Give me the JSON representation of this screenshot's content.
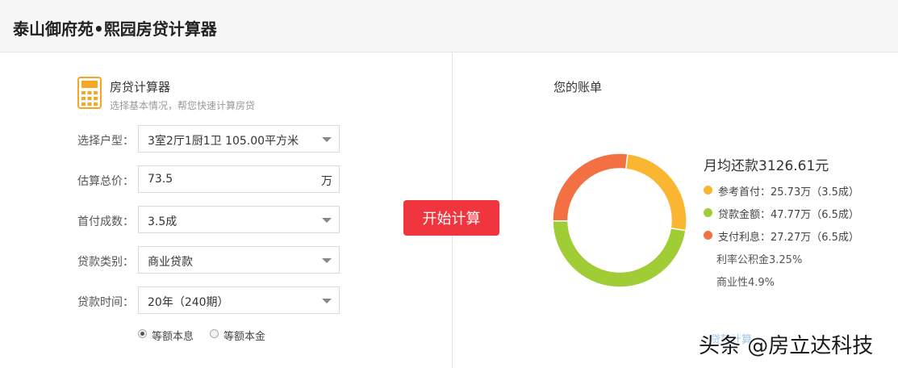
{
  "header": {
    "title": "泰山御府苑•熙园房贷计算器"
  },
  "calculator": {
    "title": "房贷计算器",
    "subtitle": "选择基本情况，帮您快速计算房贷",
    "icon": "calculator-icon"
  },
  "form": {
    "unit_type": {
      "label": "选择户型：",
      "value": "3室2厅1厨1卫 105.00平方米"
    },
    "total_price": {
      "label": "估算总价：",
      "value": "73.5",
      "unit": "万"
    },
    "down_payment": {
      "label": "首付成数：",
      "value": "3.5成"
    },
    "loan_type": {
      "label": "贷款类别：",
      "value": "商业贷款"
    },
    "loan_term": {
      "label": "贷款时间：",
      "value": "20年（240期）"
    },
    "repayment": {
      "options": [
        "等额本息",
        "等额本金"
      ],
      "selected": "等额本息"
    }
  },
  "action": {
    "calculate_label": "开始计算"
  },
  "bill": {
    "title": "您的账单",
    "monthly_payment": "月均还款3126.61元",
    "legend": [
      {
        "text": "参考首付：25.73万（3.5成）",
        "color": "#fbb631",
        "amount": 25.73
      },
      {
        "text": "贷款金额：47.77万（6.5成）",
        "color": "#a0cc35",
        "amount": 47.77
      },
      {
        "text": "支付利息：27.27万（6.5成）",
        "color": "#f37042",
        "amount": 27.27
      }
    ],
    "rate_fund": "利率公积金3.25%",
    "rate_commercial": "商业性4.9%",
    "faint_link": "贷款计算"
  },
  "watermark": "头条 @房立达科技"
}
